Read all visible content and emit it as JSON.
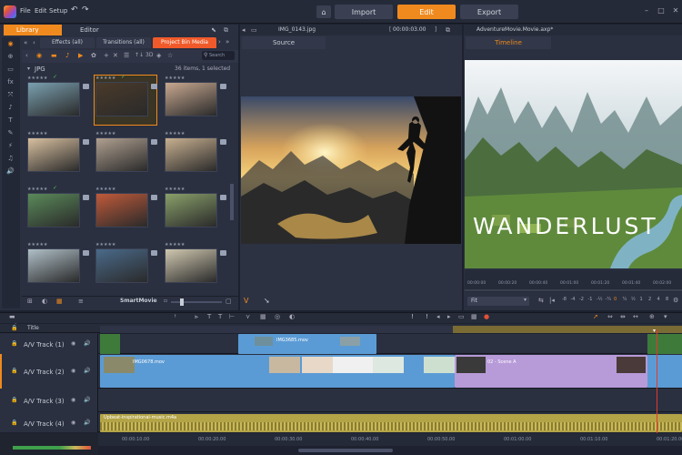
{
  "menubar": {
    "file": "File",
    "edit": "Edit",
    "setup": "Setup",
    "tabs": [
      "Import",
      "Edit",
      "Export"
    ],
    "active_tab": "Edit"
  },
  "library": {
    "library_tab": "Library",
    "editor_tab": "Editor",
    "categories": [
      "Effects (all)",
      "Transitions (all)",
      "Project Bin Media"
    ],
    "active_category": "Project Bin Media",
    "search_placeholder": "Search",
    "folder_label": "JPG",
    "count_label": "36 items, 1 selected",
    "footer_label": "SmartMovie",
    "rows": [
      [
        "",
        "",
        ""
      ],
      [
        "",
        "",
        ""
      ],
      [
        "",
        "",
        ""
      ],
      [
        "",
        "",
        ""
      ]
    ]
  },
  "source": {
    "title": "IMG_0143.jpg",
    "timecode": "00:00:03.00",
    "tab": "Source"
  },
  "preview": {
    "title": "AdventureMovie.Movie.axp*",
    "tab": "Timeline",
    "overlay_text": "WANDERLUST",
    "fit_label": "Fit",
    "ruler_ticks": [
      "00:00:00",
      "00:00:20",
      "00:00:40",
      "00:01:00",
      "00:01:20",
      "00:01:40",
      "00:02:00"
    ],
    "speed_labels": [
      "-8",
      "-4",
      "-2",
      "-1",
      "-½",
      "-¼",
      "0",
      "¼",
      "½",
      "1",
      "2",
      "4",
      "8"
    ]
  },
  "timeline": {
    "title_track": "Title",
    "tracks": [
      {
        "label": "A/V Track (1)",
        "clips": [
          "IMG3685.mov",
          ""
        ]
      },
      {
        "label": "A/V Track (2)",
        "clips": [
          "IMG0678.mov",
          "02 - Scene A"
        ]
      },
      {
        "label": "A/V Track (3)",
        "clips": []
      },
      {
        "label": "A/V Track (4)",
        "clips": [
          "Upbeat-inspirational-music.m4a"
        ]
      }
    ],
    "ruler": [
      "00:00:10.00",
      "00:00:20.00",
      "00:00:30.00",
      "00:00:40.00",
      "00:00:50.00",
      "00:01:00.00",
      "00:01:10.00",
      "00:01:20.00"
    ]
  },
  "colors": {
    "accent": "#f08a1e",
    "tab_red": "#f05a2a",
    "clip_blue": "#5b9bd5",
    "clip_purple": "#b79ad8",
    "audio": "#b3a447"
  }
}
